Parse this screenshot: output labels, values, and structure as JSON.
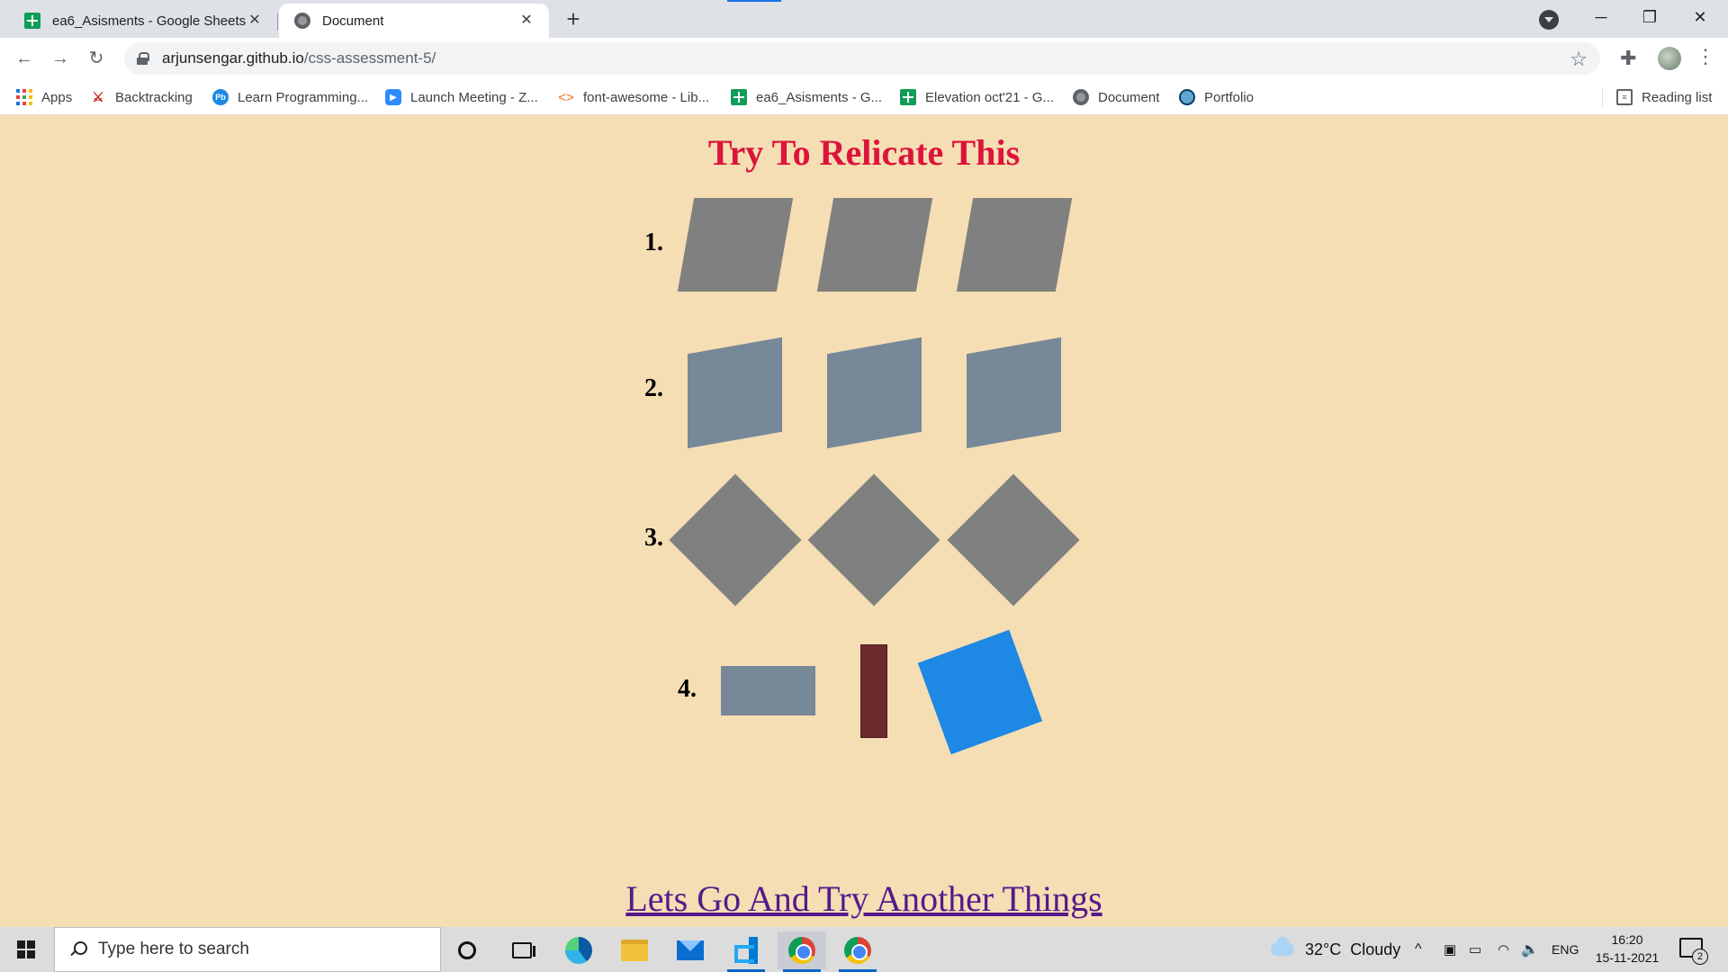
{
  "browser": {
    "tabs": [
      {
        "title": "ea6_Asisments - Google Sheets",
        "icon": "google-sheets-icon",
        "active": false
      },
      {
        "title": "Document",
        "icon": "globe-icon",
        "active": true
      }
    ],
    "new_tab_label": "+",
    "close_label": "✕",
    "url": {
      "domain": "arjunsengar.github.io",
      "path": "/css-assessment-5/"
    },
    "bookmarks": [
      {
        "label": "Apps",
        "icon": "apps-grid-icon"
      },
      {
        "label": "Backtracking",
        "icon": "backtracking-icon"
      },
      {
        "label": "Learn Programming...",
        "icon": "pb-icon"
      },
      {
        "label": "Launch Meeting - Z...",
        "icon": "zoom-icon"
      },
      {
        "label": "font-awesome - Lib...",
        "icon": "code-icon"
      },
      {
        "label": "ea6_Asisments - G...",
        "icon": "google-sheets-icon"
      },
      {
        "label": "Elevation oct'21 - G...",
        "icon": "google-sheets-icon"
      },
      {
        "label": "Document",
        "icon": "globe-icon"
      },
      {
        "label": "Portfolio",
        "icon": "portfolio-icon"
      }
    ],
    "reading_list_label": "Reading list"
  },
  "page": {
    "title": "Try To Relicate This",
    "rows": [
      {
        "label": "1."
      },
      {
        "label": "2."
      },
      {
        "label": "3."
      },
      {
        "label": "4."
      }
    ],
    "link_text": "Lets Go And Try Another Things",
    "colors": {
      "background": "#f5deb3",
      "title": "#dc143c",
      "gray": "#808080",
      "slate": "#778899",
      "maroon": "#6d2a2e",
      "blue": "#1e88e5",
      "link": "#551a8b"
    }
  },
  "taskbar": {
    "search_placeholder": "Type here to search",
    "weather": "32°C  Cloudy",
    "language": "ENG",
    "time": "16:20",
    "date": "15-11-2021",
    "notifications": "2"
  }
}
